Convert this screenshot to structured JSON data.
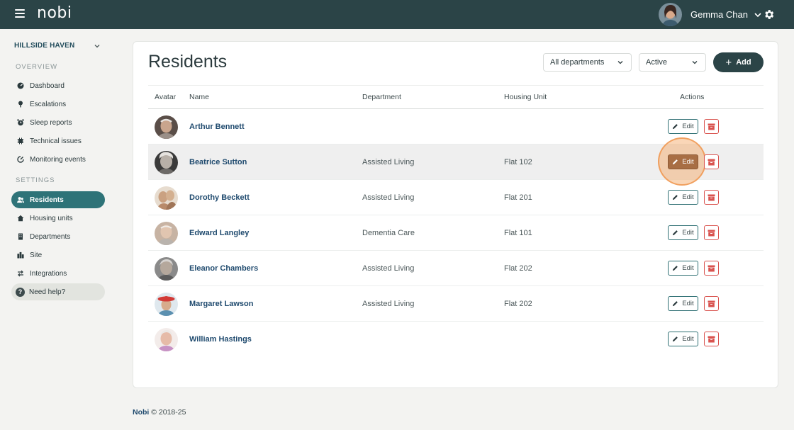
{
  "app": {
    "logo": "nobi"
  },
  "user": {
    "name": "Gemma Chan"
  },
  "sidebar": {
    "site": "HILLSIDE HAVEN",
    "overview_label": "OVERVIEW",
    "settings_label": "SETTINGS",
    "overview_items": [
      {
        "label": "Dashboard",
        "icon": "dashboard-icon"
      },
      {
        "label": "Escalations",
        "icon": "escalation-icon"
      },
      {
        "label": "Sleep reports",
        "icon": "alarm-clock-icon"
      },
      {
        "label": "Technical issues",
        "icon": "tech-issue-icon"
      },
      {
        "label": "Monitoring events",
        "icon": "monitoring-icon"
      }
    ],
    "settings_items": [
      {
        "label": "Residents",
        "icon": "users-icon",
        "active": true
      },
      {
        "label": "Housing units",
        "icon": "house-icon"
      },
      {
        "label": "Departments",
        "icon": "building-icon"
      },
      {
        "label": "Site",
        "icon": "city-icon"
      },
      {
        "label": "Integrations",
        "icon": "arrows-icon"
      }
    ],
    "help": {
      "label": "Need help?",
      "icon_glyph": "?"
    }
  },
  "main": {
    "title": "Residents",
    "filters": {
      "department": "All departments",
      "status": "Active"
    },
    "add_label": "Add",
    "columns": [
      "Avatar",
      "Name",
      "Department",
      "Housing Unit",
      "Actions"
    ],
    "edit_label": "Edit",
    "rows": [
      {
        "name": "Arthur Bennett",
        "department": "",
        "unit": ""
      },
      {
        "name": "Beatrice Sutton",
        "department": "Assisted Living",
        "unit": "Flat 102",
        "hovered": true
      },
      {
        "name": "Dorothy Beckett",
        "department": "Assisted Living",
        "unit": "Flat 201"
      },
      {
        "name": "Edward Langley",
        "department": "Dementia Care",
        "unit": "Flat 101"
      },
      {
        "name": "Eleanor Chambers",
        "department": "Assisted Living",
        "unit": "Flat 202"
      },
      {
        "name": "Margaret Lawson",
        "department": "Assisted Living",
        "unit": "Flat 202"
      },
      {
        "name": "William Hastings",
        "department": "",
        "unit": ""
      }
    ]
  },
  "footer": {
    "brand": "Nobi",
    "copyright": "© 2018-25"
  },
  "colors": {
    "topbar": "#2b4447",
    "accent": "#2e7378",
    "link": "#1f4a6e",
    "danger": "#d9534f",
    "hover_edit": "#a86e44"
  }
}
